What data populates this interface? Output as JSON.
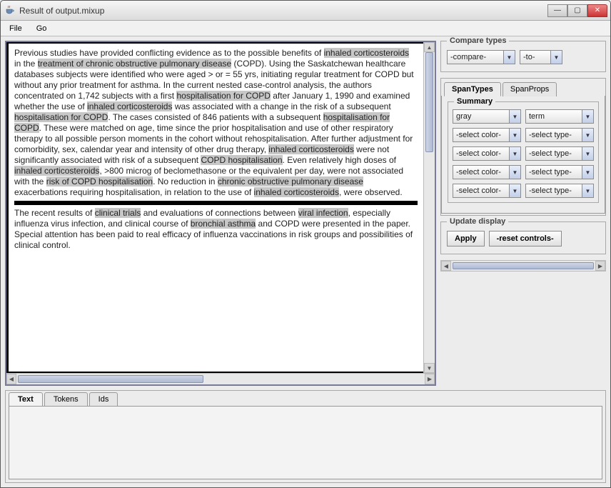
{
  "window": {
    "title": "Result of output.mixup"
  },
  "menu": {
    "file": "File",
    "go": "Go"
  },
  "doc1": {
    "t0": "Previous studies have provided conflicting evidence as to the possible benefits of ",
    "h1": "inhaled corticosteroids",
    "t1": " in the ",
    "h2": "treatment of chronic obstructive pulmonary disease",
    "t2": " (COPD). Using the Saskatchewan healthcare databases subjects were identified who were aged > or = 55 yrs, initiating regular treatment for COPD but without any prior treatment for asthma. In the current nested case-control analysis, the authors concentrated on 1,742 subjects with a first ",
    "h3": "hospitalisation for COPD",
    "t3": " after January 1, 1990 and examined whether the use of ",
    "h4": "inhaled corticosteroids",
    "t4": " was associated with a change in the risk of a subsequent ",
    "h5": "hospitalisation for COPD",
    "t5": ". The cases consisted of 846 patients with a subsequent ",
    "h6": "hospitalisation for COPD",
    "t6": ". These were matched on age, time since the prior hospitalisation and use of other respiratory therapy to all possible person moments in the cohort without rehospitalisation. After further adjustment for comorbidity, sex, calendar year and intensity of other drug therapy, ",
    "h7": "inhaled corticosteroids",
    "t7": " were not significantly associated with risk of a subsequent ",
    "h8": "COPD hospitalisation",
    "t8": ". Even relatively high doses of ",
    "h9": "inhaled corticosteroids",
    "t9": ", >800 microg of beclomethasone or the equivalent per day, were not associated with the ",
    "h10": "risk of COPD hospitalisation",
    "t10": ". No reduction in ",
    "h11": "chronic obstructive pulmonary disease",
    "t11": " exacerbations requiring hospitalisation, in relation to the use of ",
    "h12": "inhaled corticosteroids",
    "t12": ", were observed."
  },
  "doc2": {
    "t0": "The recent results of ",
    "h1": "clinical trials",
    "t1": " and evaluations of connections between ",
    "h2": "viral infection",
    "t2": ", especially influenza virus infection, and clinical course of ",
    "h3": "bronchial asthma",
    "t3": " and COPD were presented in the paper. Special attention has been paid to real efficacy of influenza vaccinations in risk groups and possibilities of clinical control."
  },
  "compare": {
    "legend": "Compare types",
    "left": "-compare-",
    "right": "-to-"
  },
  "spanTypes": {
    "tab1": "SpanTypes",
    "tab2": "SpanProps",
    "summaryLegend": "Summary",
    "row1color": "gray",
    "row1type": "term",
    "placeholderColor": "-select color-",
    "placeholderType": "-select type-"
  },
  "update": {
    "legend": "Update display",
    "apply": "Apply",
    "reset": "-reset controls-"
  },
  "bottomTabs": {
    "text": "Text",
    "tokens": "Tokens",
    "ids": "Ids"
  }
}
